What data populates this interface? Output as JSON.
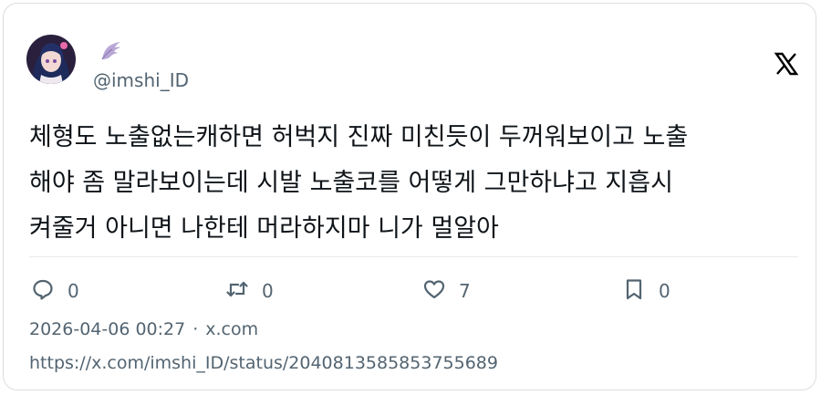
{
  "author": {
    "handle": "@imshi_ID",
    "avatar_icon": "anime-girl-avatar",
    "name_icon": "angel-wing-icon"
  },
  "brand": {
    "logo_icon": "x-logo-icon",
    "color": "#000000"
  },
  "tweet": {
    "text": "체형도 노출없는캐하면 허벅지 진짜 미친듯이 두꺼워보이고 노출\n해야 좀 말라보이는데 시발 노출코를 어떻게 그만하냐고 지흡시\n켜줄거 아니면 나한테 머라하지마 니가 멀알아"
  },
  "actions": {
    "reply": {
      "icon": "reply-icon",
      "count": "0"
    },
    "retweet": {
      "icon": "retweet-icon",
      "count": "0"
    },
    "like": {
      "icon": "heart-icon",
      "count": "7"
    },
    "bookmark": {
      "icon": "bookmark-icon",
      "count": "0"
    }
  },
  "meta": {
    "timestamp": "2026-04-06 00:27",
    "separator": "·",
    "source": "x.com"
  },
  "url": "https://x.com/imshi_ID/status/2040813585853755689",
  "colors": {
    "text": "#0f1419",
    "secondary": "#536471",
    "border": "#d9dde1"
  }
}
